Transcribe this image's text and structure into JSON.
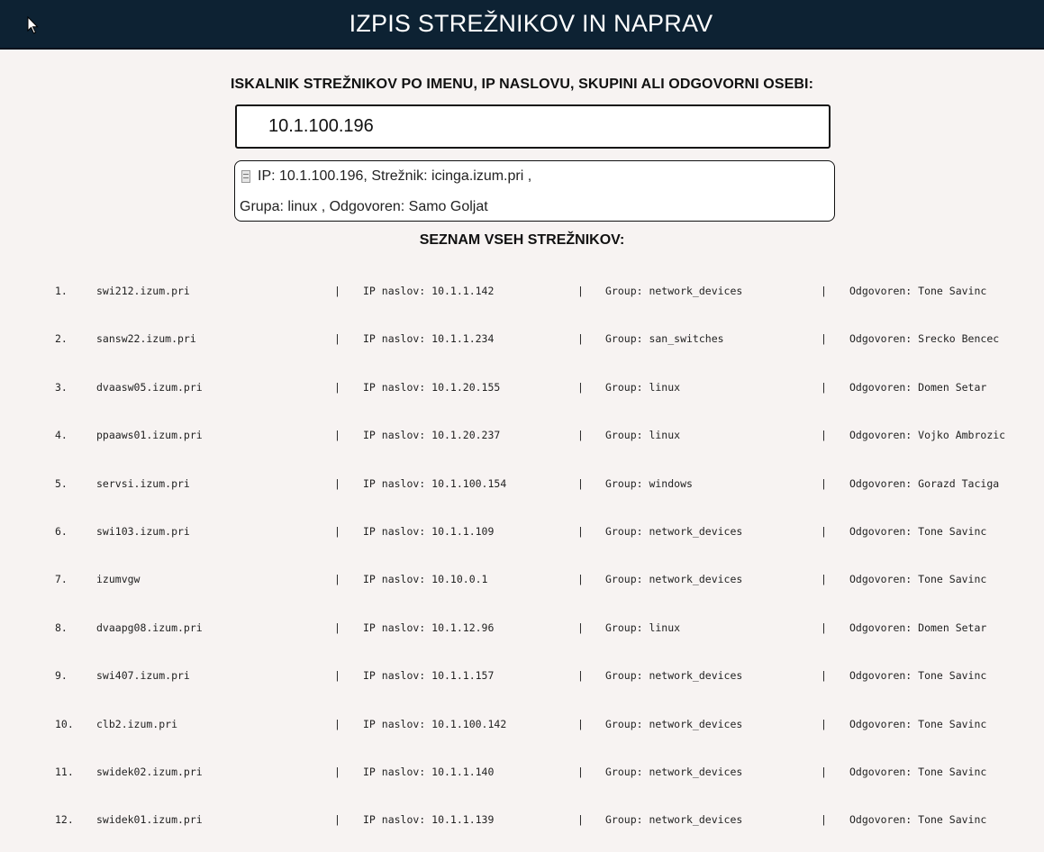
{
  "header": {
    "title": "IZPIS STREŽNIKOV IN NAPRAV"
  },
  "search": {
    "label": "ISKALNIK STREŽNIKOV PO IMENU, IP NASLOVU, SKUPINI ALI ODGOVORNI OSEBI:",
    "value": "10.1.100.196"
  },
  "result": {
    "line1": "IP: 10.1.100.196, Strežnik: icinga.izum.pri ,",
    "line2": "Grupa: linux , Odgovoren: Samo Goljat"
  },
  "list": {
    "title": "SEZNAM VSEH STREŽNIKOV:",
    "separator": "|",
    "rows": [
      {
        "num": "1.",
        "name": "swi212.izum.pri",
        "ip": "IP naslov: 10.1.1.142",
        "group": "Group: network_devices",
        "owner": "Odgovoren: Tone Savinc"
      },
      {
        "num": "2.",
        "name": "sansw22.izum.pri",
        "ip": "IP naslov: 10.1.1.234",
        "group": "Group: san_switches",
        "owner": "Odgovoren: Srecko Bencec"
      },
      {
        "num": "3.",
        "name": "dvaasw05.izum.pri",
        "ip": "IP naslov: 10.1.20.155",
        "group": "Group: linux",
        "owner": "Odgovoren: Domen Setar"
      },
      {
        "num": "4.",
        "name": "ppaaws01.izum.pri",
        "ip": "IP naslov: 10.1.20.237",
        "group": "Group: linux",
        "owner": "Odgovoren: Vojko Ambrozic"
      },
      {
        "num": "5.",
        "name": "servsi.izum.pri",
        "ip": "IP naslov: 10.1.100.154",
        "group": "Group: windows",
        "owner": "Odgovoren: Gorazd Taciga"
      },
      {
        "num": "6.",
        "name": "swi103.izum.pri",
        "ip": "IP naslov: 10.1.1.109",
        "group": "Group: network_devices",
        "owner": "Odgovoren: Tone Savinc"
      },
      {
        "num": "7.",
        "name": "izumvgw",
        "ip": "IP naslov: 10.10.0.1",
        "group": "Group: network_devices",
        "owner": "Odgovoren: Tone Savinc"
      },
      {
        "num": "8.",
        "name": "dvaapg08.izum.pri",
        "ip": "IP naslov: 10.1.12.96",
        "group": "Group: linux",
        "owner": "Odgovoren: Domen Setar"
      },
      {
        "num": "9.",
        "name": "swi407.izum.pri",
        "ip": "IP naslov: 10.1.1.157",
        "group": "Group: network_devices",
        "owner": "Odgovoren: Tone Savinc"
      },
      {
        "num": "10.",
        "name": "clb2.izum.pri",
        "ip": "IP naslov: 10.1.100.142",
        "group": "Group: network_devices",
        "owner": "Odgovoren: Tone Savinc"
      },
      {
        "num": "11.",
        "name": "swidek02.izum.pri",
        "ip": "IP naslov: 10.1.1.140",
        "group": "Group: network_devices",
        "owner": "Odgovoren: Tone Savinc"
      },
      {
        "num": "12.",
        "name": "swidek01.izum.pri",
        "ip": "IP naslov: 10.1.1.139",
        "group": "Group: network_devices",
        "owner": "Odgovoren: Tone Savinc"
      }
    ]
  },
  "icons": {
    "cursor": "mouse-pointer-icon",
    "server": "server-icon"
  },
  "colors": {
    "header_bg": "#0d2233",
    "page_bg": "#f7f3f2"
  }
}
